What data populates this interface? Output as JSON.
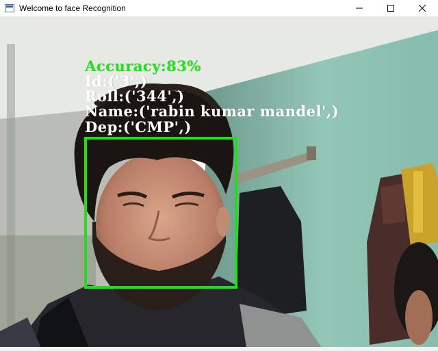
{
  "window": {
    "title": "Welcome to face Recognition",
    "icon": "app-window-icon",
    "controls": [
      "minimize-icon",
      "maximize-icon",
      "close-icon"
    ]
  },
  "overlay": {
    "accuracy": "Accuracy:83%",
    "id": "Id:('3',)",
    "roll": "Roll:('344',)",
    "name": "Name:('rabin kumar mandel',)",
    "dep": "Dep:('CMP',)"
  },
  "colors": {
    "detection_box": "#22dd1c",
    "accuracy_text": "#22e01c",
    "info_text": "#ffffff",
    "wall": "#8fc3b3",
    "ceiling": "#eaece8"
  }
}
